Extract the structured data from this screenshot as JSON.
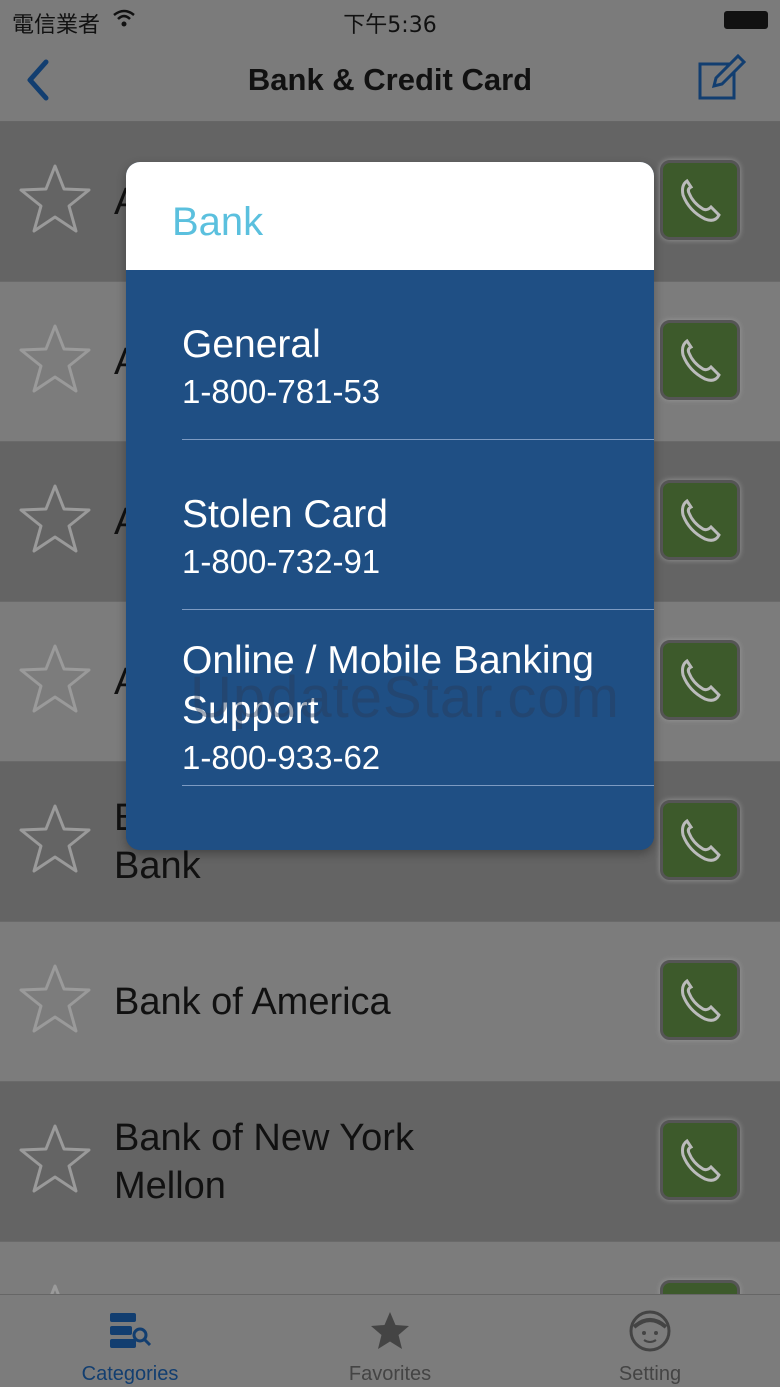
{
  "status_bar": {
    "carrier": "電信業者",
    "time": "下午5:36"
  },
  "nav": {
    "title": "Bank & Credit Card"
  },
  "list": {
    "rows": [
      {
        "name": "A"
      },
      {
        "name": "A"
      },
      {
        "name": "A"
      },
      {
        "name": "A"
      },
      {
        "name": "B\nBank"
      },
      {
        "name": "Bank of America"
      },
      {
        "name": "Bank of New York\nMellon"
      },
      {
        "name": ""
      }
    ]
  },
  "modal": {
    "title": "Bank",
    "entries": [
      {
        "label": "General",
        "number": "1-800-781-53"
      },
      {
        "label": "Stolen Card",
        "number": "1-800-732-91"
      },
      {
        "label": "Online / Mobile Banking\nSupport",
        "number": "1-800-933-62"
      }
    ]
  },
  "watermark": "UpdateStar.com",
  "tabs": [
    {
      "label": "Categories",
      "icon": "categories-icon",
      "active": true
    },
    {
      "label": "Favorites",
      "icon": "star-icon",
      "active": false
    },
    {
      "label": "Setting",
      "icon": "face-icon",
      "active": false
    }
  ],
  "colors": {
    "accent": "#123e70",
    "modal_body": "#1f4f84",
    "modal_title": "#5bc0de"
  }
}
